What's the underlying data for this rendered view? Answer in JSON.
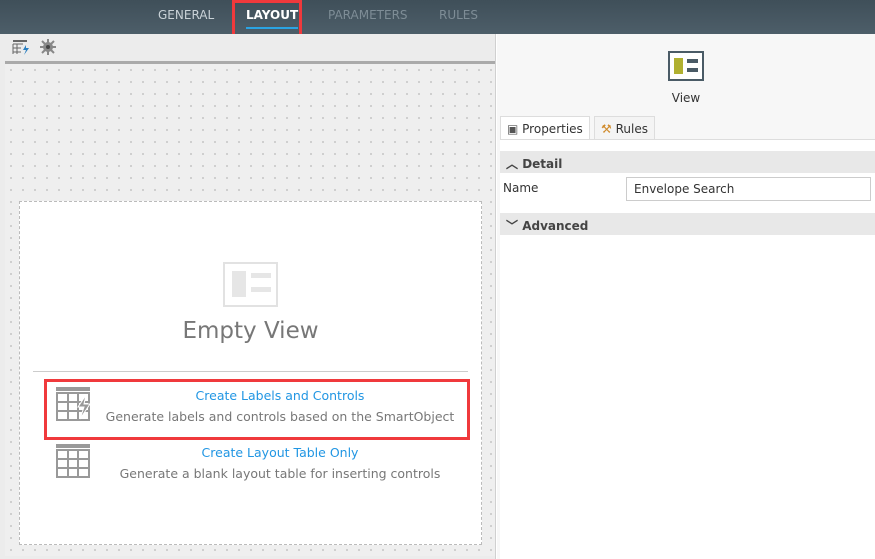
{
  "tabs": [
    {
      "label": "GENERAL"
    },
    {
      "label": "LAYOUT"
    },
    {
      "label": "PARAMETERS"
    },
    {
      "label": "RULES"
    }
  ],
  "canvas": {
    "title": "Empty View",
    "options": [
      {
        "title": "Create Labels and Controls",
        "desc": "Generate labels and controls based on the SmartObject"
      },
      {
        "title": "Create Layout Table Only",
        "desc": "Generate a blank layout table for inserting controls"
      }
    ]
  },
  "panel": {
    "icon_label": "View",
    "tabs": [
      "Properties",
      "Rules"
    ],
    "detail": "Detail",
    "name_label": "Name",
    "name_value": "Envelope Search",
    "advanced": "Advanced"
  },
  "colors": {
    "accent": "#2aa4e4",
    "highlight": "#f0393c",
    "link": "#2196e3"
  }
}
